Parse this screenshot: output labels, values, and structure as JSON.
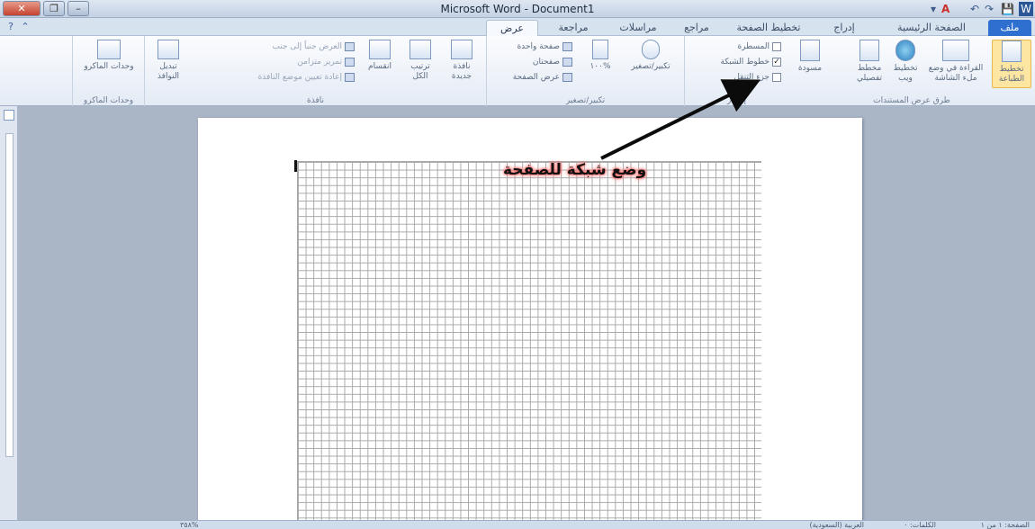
{
  "window": {
    "title": "Microsoft Word - Document1"
  },
  "quick_access": {
    "save": "💾",
    "word": "W",
    "undo": "↶",
    "redo": "↷",
    "font_color": "A",
    "dropdown": "▾"
  },
  "tabs": [
    {
      "key": "file",
      "label": "ملف"
    },
    {
      "key": "home",
      "label": "الصفحة الرئيسية"
    },
    {
      "key": "insert",
      "label": "إدراج"
    },
    {
      "key": "layout",
      "label": "تخطيط الصفحة"
    },
    {
      "key": "references",
      "label": "مراجع"
    },
    {
      "key": "mailings",
      "label": "مراسلات"
    },
    {
      "key": "review",
      "label": "مراجعة"
    },
    {
      "key": "view",
      "label": "عرض"
    }
  ],
  "ribbon": {
    "doc_views": {
      "label": "طرق عرض المستندات",
      "print_layout": "تخطيط الطباعة",
      "full_screen": "القراءة في وضع ملء الشاشة",
      "web_layout": "تخطيط ويب",
      "outline": "مخطط تفصيلي",
      "draft": "مسودة"
    },
    "show": {
      "label": "إظهار",
      "ruler": "المسطرة",
      "gridlines": "خطوط الشبكة",
      "nav_pane": "جزء التنقل",
      "gridlines_checked": "✓"
    },
    "zoom": {
      "label": "تكبير/تصغير",
      "zoom": "تكبير/تصغير",
      "percent": "١٠٠%",
      "one_page": "صفحة واحدة",
      "two_pages": "صفحتان",
      "page_width": "عرض الصفحة"
    },
    "window": {
      "label": "نافذة",
      "new_window": "نافذة جديدة",
      "arrange_all": "ترتيب الكل",
      "split": "انقسام",
      "side_by_side": "العرض جنباً إلى جنب",
      "sync_scroll": "تمرير متزامن",
      "reset_position": "إعادة تعيين موضع النافذة",
      "switch_windows": "تبديل النوافذ"
    },
    "macros": {
      "label": "وحدات الماكرو",
      "button": "وحدات الماكرو"
    }
  },
  "annotation": {
    "text": "وضع شبكة للصفحة"
  },
  "statusbar": {
    "page": "الصفحة: ١ من ١",
    "words": "الكلمات: ٠",
    "language": "العربية (السعودية)",
    "zoom": "٣٥٨%"
  },
  "colors": {
    "file_tab": "#2f6fd0",
    "arrow": "#0b0b0b",
    "annotation_glow": "#ff6a6a",
    "selected_view": "#fde6a2"
  },
  "icons": {
    "close": "close-icon",
    "help": "help-icon"
  }
}
